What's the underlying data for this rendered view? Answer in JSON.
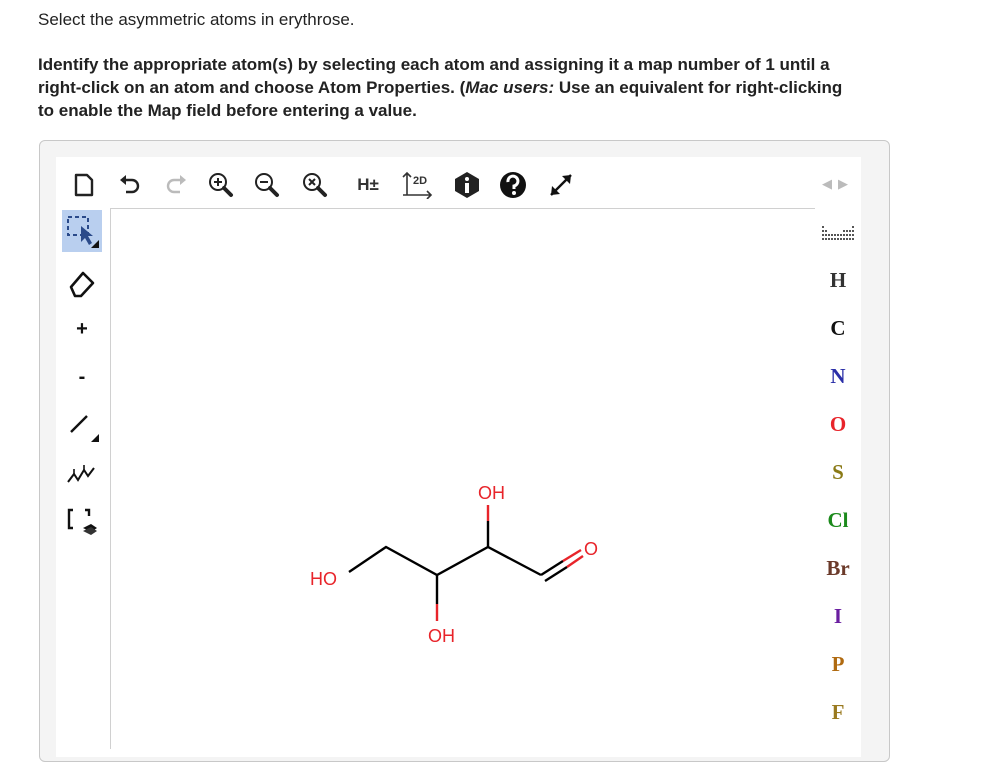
{
  "question": {
    "line1": "Select the asymmetric atoms in erythrose.",
    "instr_1": "Identify the appropriate atom(s) by selecting each atom and assigning it a map number of 1 until a",
    "instr_2a": "right-click on an atom and choose Atom Properties. (",
    "instr_2b": "Mac users:",
    "instr_2c": " Use an equivalent for right-clicking",
    "instr_3": "to enable the Map field before entering a value."
  },
  "toolbar": {
    "h_label": "H±",
    "twod_label": "2D"
  },
  "left_tools": {
    "plus": "+",
    "minus": "-"
  },
  "elements": [
    {
      "symbol": "H",
      "color": "#333333"
    },
    {
      "symbol": "C",
      "color": "#111111"
    },
    {
      "symbol": "N",
      "color": "#2b2fa8"
    },
    {
      "symbol": "O",
      "color": "#e8242a"
    },
    {
      "symbol": "S",
      "color": "#8a7a16"
    },
    {
      "symbol": "Cl",
      "color": "#1c8a1c"
    },
    {
      "symbol": "Br",
      "color": "#6b3a2a"
    },
    {
      "symbol": "I",
      "color": "#6a1ea0"
    },
    {
      "symbol": "P",
      "color": "#b06a10"
    },
    {
      "symbol": "F",
      "color": "#9a7a20"
    }
  ],
  "molecule": {
    "name": "erythrose",
    "labels": {
      "ho_left": "HO",
      "oh_top": "OH",
      "oh_bottom": "OH",
      "o_aldehyde": "O"
    }
  }
}
